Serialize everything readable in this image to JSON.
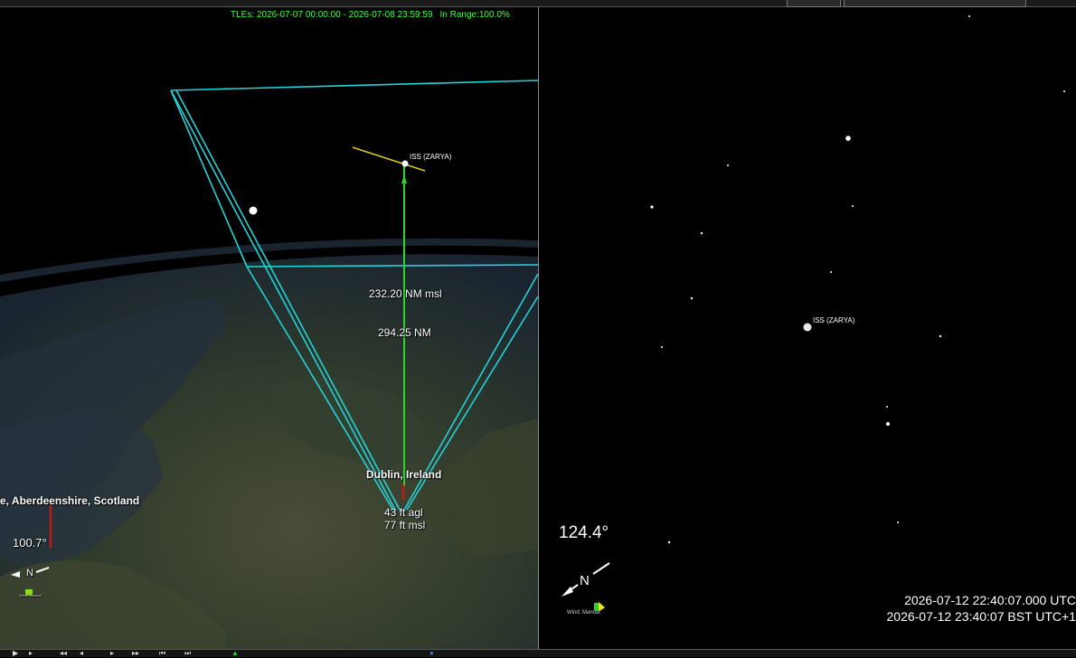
{
  "left_view": {
    "tle_range": "TLEs: 2026-07-07 00:00:00 - 2026-07-08 23:59:59",
    "in_range": "In Range:100.0%",
    "satellite_label": "ISS (ZARYA)",
    "altitude_msl": "232.20 NM msl",
    "slant_range": "294.25 NM",
    "observer_name": "Dublin, Ireland",
    "observer_agl": "43 ft agl",
    "observer_msl": "77 ft msl",
    "secondary_location": "e, Aberdeenshire, Scotland",
    "heading_readout": "100.7°",
    "compass_letter": "N",
    "wind_label": "Wind: Manual"
  },
  "right_view": {
    "satellite_label": "ISS (ZARYA)",
    "heading_readout": "124.4°",
    "compass_letter": "N",
    "wind_label": "Wind: Manual",
    "time_utc": "2026-07-12 22:40:07.000 UTC",
    "time_local": "2026-07-12 23:40:07 BST UTC+1"
  },
  "colors": {
    "frustum": "#22d3d8",
    "track": "#2ad62a",
    "orbit": "#d8c82a",
    "marker": "#e01010",
    "tle_text": "#3dff3d"
  }
}
